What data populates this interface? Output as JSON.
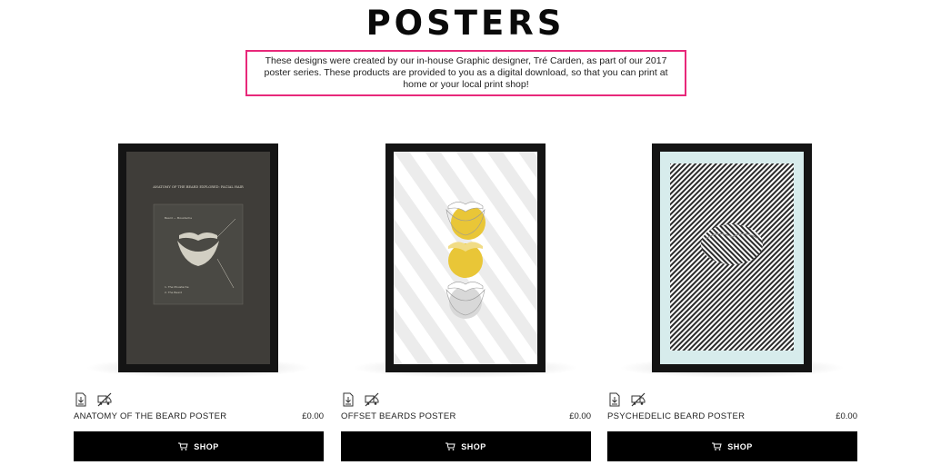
{
  "page": {
    "title": "POSTERS",
    "intro": "These designs were created by our in-house Graphic designer, Tré Carden, as part of our 2017 poster series. These products are provided to you as a digital download, so that you can print at home or your local print shop!"
  },
  "colors": {
    "intro_border": "#e8287a",
    "button_bg": "#000000",
    "frame": "#141414"
  },
  "products": [
    {
      "name": "ANATOMY OF THE BEARD POSTER",
      "price": "£0.00",
      "button_label": "SHOP",
      "icons": [
        "download-icon",
        "no-shipping-icon"
      ],
      "art": {
        "heading": "ANATOMY OF THE BEARD EXPLORED: FACIAL HAIR",
        "label": "Beard — Moustache",
        "notes": [
          "1. The Moustache",
          "2. The Beard"
        ]
      }
    },
    {
      "name": "OFFSET BEARDS POSTER",
      "price": "£0.00",
      "button_label": "SHOP",
      "icons": [
        "download-icon",
        "no-shipping-icon"
      ]
    },
    {
      "name": "PSYCHEDELIC BEARD POSTER",
      "price": "£0.00",
      "button_label": "SHOP",
      "icons": [
        "download-icon",
        "no-shipping-icon"
      ]
    }
  ]
}
